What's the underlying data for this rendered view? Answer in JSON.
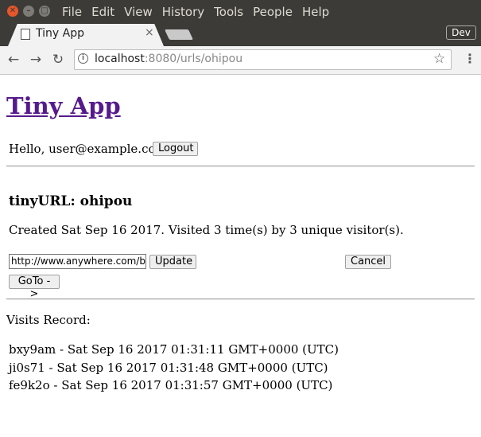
{
  "browser": {
    "menu": [
      "File",
      "Edit",
      "View",
      "History",
      "Tools",
      "People",
      "Help"
    ],
    "tab_title": "Tiny App",
    "tab_close": "×",
    "profile_badge": "Dev",
    "url_host": "localhost",
    "url_rest": ":8080/urls/ohipou"
  },
  "page": {
    "app_title": "Tiny App",
    "greeting": "Hello, user@example.com!",
    "logout_label": "Logout",
    "tinyurl_heading": "tinyURL: ohipou",
    "created_text": "Created Sat Sep 16 2017. Visited 3 time(s) by 3 unique visitor(s).",
    "long_url_value": "http://www.anywhere.com/bu",
    "update_label": "Update",
    "cancel_label": "Cancel",
    "goto_label": "GoTo ->",
    "visits_title": "Visits Record:",
    "visits": [
      "bxy9am - Sat Sep 16 2017 01:31:11 GMT+0000 (UTC)",
      "ji0s71 - Sat Sep 16 2017 01:31:48 GMT+0000 (UTC)",
      "fe9k2o - Sat Sep 16 2017 01:31:57 GMT+0000 (UTC)"
    ]
  },
  "colors": {
    "title_link": "#551a8b",
    "chrome_dark": "#3c3b37",
    "close_button": "#e8562b"
  }
}
